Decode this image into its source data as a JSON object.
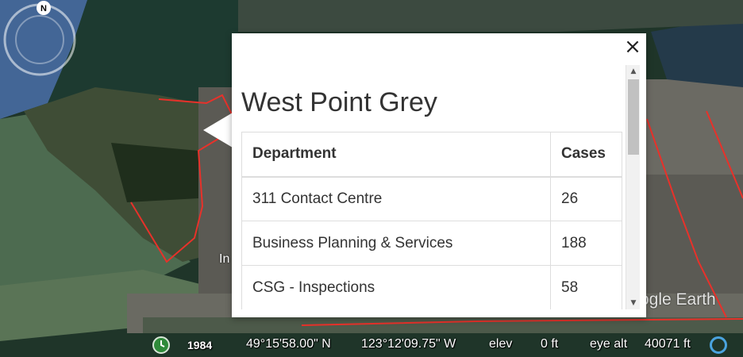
{
  "balloon": {
    "title": "West Point Grey",
    "close_label": "×",
    "table": {
      "headers": [
        "Department",
        "Cases"
      ],
      "rows": [
        [
          "311 Contact Centre",
          "26"
        ],
        [
          "Business Planning & Services",
          "188"
        ],
        [
          "CSG - Inspections",
          "58"
        ]
      ]
    },
    "scroll_up_icon": "▲",
    "scroll_down_icon": "▼"
  },
  "map": {
    "place_label_fragment": "In",
    "logo_text": "ogle Earth",
    "compass_letter": "N",
    "boundary_color": "#e8312a"
  },
  "status": {
    "year": "1984",
    "lat": "49°15'58.00\" N",
    "lon": "123°12'09.75\" W",
    "elev_label": "elev",
    "elev_value": "0 ft",
    "eye_label": "eye alt",
    "eye_value": "40071 ft"
  }
}
